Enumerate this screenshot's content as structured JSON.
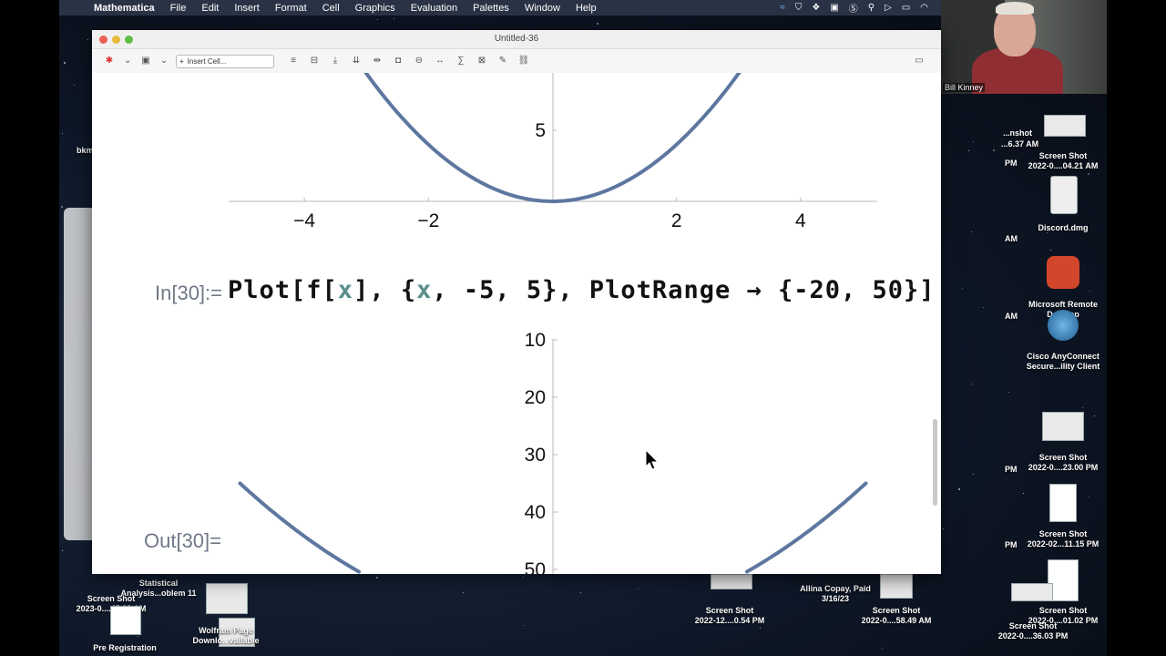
{
  "menubar": {
    "app": "Mathematica",
    "items": [
      "File",
      "Edit",
      "Insert",
      "Format",
      "Cell",
      "Graphics",
      "Evaluation",
      "Palettes",
      "Window",
      "Help"
    ]
  },
  "webcam": {
    "name": "Bill Kinney"
  },
  "window": {
    "title": "Untitled-36",
    "toolbar": {
      "insert_cell": "Insert Cell..."
    }
  },
  "plot1": {
    "y_ticks": [
      "5"
    ],
    "x_ticks": [
      "−4",
      "−2",
      "2",
      "4"
    ]
  },
  "input": {
    "label": "In[30]:=",
    "code_parts": [
      "Plot[f[",
      "x",
      "], {",
      "x",
      ", -5, 5}, PlotRange → {-20, 50}]"
    ]
  },
  "plot2": {
    "y_ticks": [
      "50",
      "40",
      "30",
      "20",
      "10"
    ]
  },
  "output": {
    "label": "Out[30]="
  },
  "chart_data": [
    {
      "type": "line",
      "title": "",
      "xlabel": "",
      "ylabel": "",
      "xlim": [
        -5,
        5
      ],
      "ylim": [
        0,
        7
      ],
      "x_ticks": [
        -4,
        -2,
        2,
        4
      ],
      "y_ticks": [
        5
      ],
      "series": [
        {
          "function": "x^2",
          "x_range": [
            -5,
            5
          ]
        }
      ]
    },
    {
      "type": "line",
      "title": "",
      "xlabel": "",
      "ylabel": "",
      "xlim": [
        -5,
        5
      ],
      "ylim": [
        -20,
        50
      ],
      "y_ticks": [
        10,
        20,
        30,
        40,
        50
      ],
      "series": [
        {
          "function": "x^2",
          "x_range": [
            -5,
            5
          ]
        }
      ]
    }
  ],
  "desktop": {
    "right_items": [
      {
        "label": "Screen Shot",
        "sub": "2022-0....04.21 AM"
      },
      {
        "label": "Discord.dmg",
        "sub": ""
      },
      {
        "label": "Microsoft Remote",
        "sub": "Desktop"
      },
      {
        "label": "Cisco AnyConnect",
        "sub": "Secure...ility Client"
      },
      {
        "label": "Screen Shot",
        "sub": "2022-0....23.00 PM"
      },
      {
        "label": "Screen Shot",
        "sub": "2022-02...11.15 PM"
      },
      {
        "label": "Screen Shot",
        "sub": "2022-0....01.02 PM"
      }
    ],
    "partial_right": [
      "...nshot",
      "...6.37 AM",
      "PM",
      "AM",
      "AM",
      "PM",
      "PM"
    ],
    "bottom_items": [
      {
        "label": "Screen Shot",
        "sub": "2022-12....0.54 PM"
      },
      {
        "label": "Allina Copay, Paid",
        "sub": "3/16/23"
      },
      {
        "label": "Screen Shot",
        "sub": "2022-0....58.49 AM"
      },
      {
        "label": "Screen Shot",
        "sub": "2022-0....36.03 PM"
      }
    ],
    "left_items": [
      {
        "label": "Statistical",
        "sub": "Analysis...oblem 11"
      },
      {
        "label": "Screen Shot",
        "sub": "2023-0....45.38 AM"
      },
      {
        "label": "Wolfram Page",
        "sub": "Downlo...vailable"
      },
      {
        "label": "Pre Registration",
        "sub": ""
      }
    ],
    "misc": [
      "bkm"
    ]
  }
}
